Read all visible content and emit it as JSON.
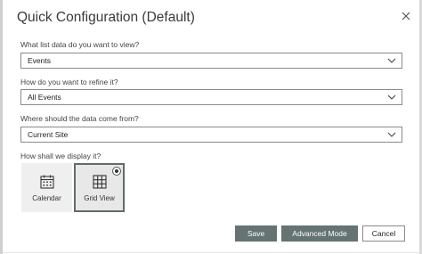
{
  "dialog": {
    "title": "Quick Configuration (Default)",
    "close_icon": "close-icon"
  },
  "fields": [
    {
      "label": "What list data do you want to view?",
      "value": "Events"
    },
    {
      "label": "How do you want to refine it?",
      "value": "All Events"
    },
    {
      "label": "Where should the data come from?",
      "value": "Current Site"
    }
  ],
  "display": {
    "label": "How shall we display it?",
    "options": [
      {
        "label": "Calendar",
        "icon": "calendar-icon",
        "selected": false
      },
      {
        "label": "Grid View",
        "icon": "grid-icon",
        "selected": true
      }
    ]
  },
  "buttons": {
    "save": "Save",
    "advanced": "Advanced Mode",
    "cancel": "Cancel"
  },
  "colors": {
    "primary_button": "#667373",
    "selected_border": "#616b6b"
  }
}
